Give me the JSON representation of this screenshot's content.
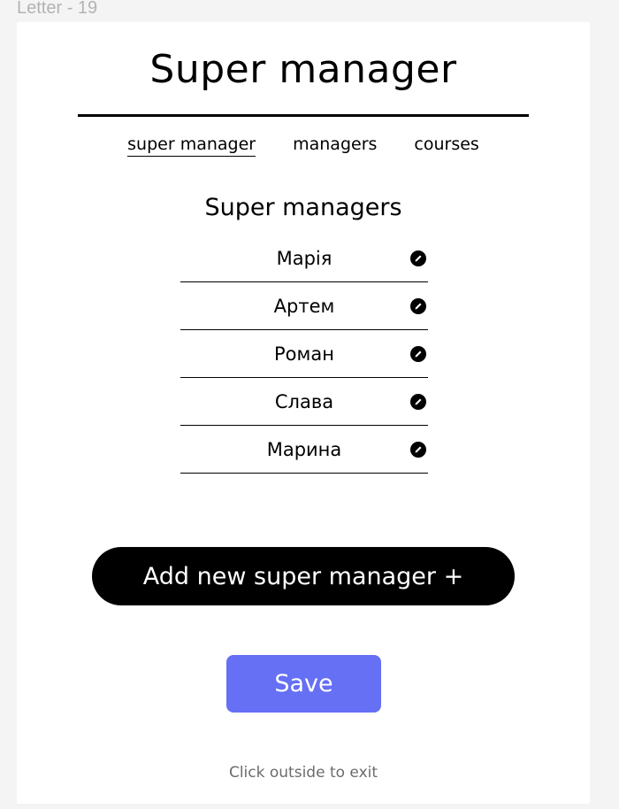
{
  "frame_label": "Letter - 19",
  "title": "Super manager",
  "tabs": [
    {
      "label": "super manager",
      "active": true
    },
    {
      "label": "managers",
      "active": false
    },
    {
      "label": "courses",
      "active": false
    }
  ],
  "section_title": "Super managers",
  "managers": [
    {
      "name": "Марія",
      "icon": "pencil-icon"
    },
    {
      "name": "Артем",
      "icon": "pencil-icon"
    },
    {
      "name": "Роман",
      "icon": "pencil-icon"
    },
    {
      "name": "Слава",
      "icon": "pencil-icon"
    },
    {
      "name": "Марина",
      "icon": "pencil-icon"
    }
  ],
  "add_button_label": "Add new super manager +",
  "save_button_label": "Save",
  "exit_hint": "Click outside to exit",
  "colors": {
    "save_button": "#6570f4",
    "add_button": "#000000",
    "background": "#f4f4f4"
  }
}
